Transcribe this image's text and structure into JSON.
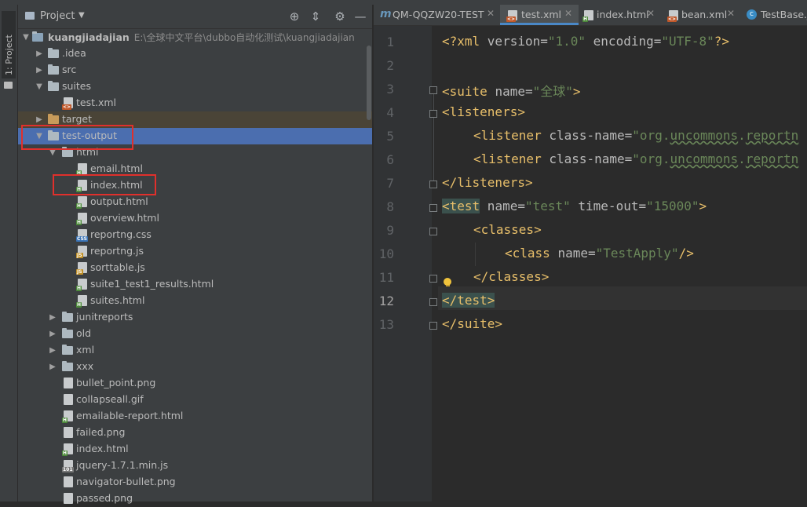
{
  "side_strip": {
    "tab_label": "1: Project"
  },
  "project_panel": {
    "title": "Project",
    "tree": [
      {
        "label": "kuangjiadajian",
        "path": "E:\\全球中文平台\\dubbo自动化测试\\kuangjiadajian",
        "icon": "module-folder-icon"
      },
      {
        "label": ".idea",
        "icon": "folder-icon"
      },
      {
        "label": "src",
        "icon": "folder-icon"
      },
      {
        "label": "suites",
        "icon": "folder-icon"
      },
      {
        "label": "test.xml",
        "icon": "xml-file-icon"
      },
      {
        "label": "target",
        "icon": "folder-icon"
      },
      {
        "label": "test-output",
        "icon": "folder-icon"
      },
      {
        "label": "html",
        "icon": "folder-icon"
      },
      {
        "label": "email.html",
        "icon": "html-file-icon"
      },
      {
        "label": "index.html",
        "icon": "html-file-icon"
      },
      {
        "label": "output.html",
        "icon": "html-file-icon"
      },
      {
        "label": "overview.html",
        "icon": "html-file-icon"
      },
      {
        "label": "reportng.css",
        "icon": "css-file-icon"
      },
      {
        "label": "reportng.js",
        "icon": "js-file-icon"
      },
      {
        "label": "sorttable.js",
        "icon": "js-file-icon"
      },
      {
        "label": "suite1_test1_results.html",
        "icon": "html-file-icon"
      },
      {
        "label": "suites.html",
        "icon": "html-file-icon"
      },
      {
        "label": "junitreports",
        "icon": "folder-icon"
      },
      {
        "label": "old",
        "icon": "folder-icon"
      },
      {
        "label": "xml",
        "icon": "folder-icon"
      },
      {
        "label": "xxx",
        "icon": "folder-icon"
      },
      {
        "label": "bullet_point.png",
        "icon": "image-file-icon"
      },
      {
        "label": "collapseall.gif",
        "icon": "image-file-icon"
      },
      {
        "label": "emailable-report.html",
        "icon": "html-file-icon"
      },
      {
        "label": "failed.png",
        "icon": "image-file-icon"
      },
      {
        "label": "index.html",
        "icon": "html-file-icon"
      },
      {
        "label": "jquery-1.7.1.min.js",
        "icon": "js-file-icon"
      },
      {
        "label": "navigator-bullet.png",
        "icon": "image-file-icon"
      },
      {
        "label": "passed.png",
        "icon": "image-file-icon"
      }
    ]
  },
  "editor": {
    "tabs": [
      {
        "label": "QM-QQZW20-TEST",
        "active": false
      },
      {
        "label": "test.xml",
        "active": true
      },
      {
        "label": "index.html",
        "active": false
      },
      {
        "label": "bean.xml",
        "active": false
      },
      {
        "label": "TestBase.j",
        "active": false
      }
    ],
    "line_numbers": [
      "1",
      "2",
      "3",
      "4",
      "5",
      "6",
      "7",
      "8",
      "9",
      "10",
      "11",
      "12",
      "13"
    ],
    "current_line": "12",
    "code": {
      "l1_open": "<?xml ",
      "l1_attr1": "version=",
      "l1_val1": "\"1.0\"",
      "l1_attr2": " encoding=",
      "l1_val2": "\"UTF-8\"",
      "l1_close": "?>",
      "l3_tag": "<suite ",
      "l3_attr": "name=",
      "l3_val": "\"全球\"",
      "l3_end": ">",
      "l4": "<listeners>",
      "l5_tag": "<listener ",
      "l5_attr": "class-name=",
      "l5_val_a": "\"org.",
      "l5_val_b": "uncommons",
      "l5_val_c": ".",
      "l5_val_d": "reportn",
      "l6_tag": "<listener ",
      "l6_attr": "class-name=",
      "l6_val_a": "\"org.",
      "l6_val_b": "uncommons",
      "l6_val_c": ".",
      "l6_val_d": "reportn",
      "l7": "</listeners>",
      "l8_tag": "<test",
      "l8_attr1": " name=",
      "l8_val1": "\"test\"",
      "l8_attr2": " time-out=",
      "l8_val2": "\"15000\"",
      "l8_end": ">",
      "l9": "<classes>",
      "l10_tag": "<class ",
      "l10_attr": "name=",
      "l10_val": "\"TestApply\"",
      "l10_end": "/>",
      "l11": "</classes>",
      "l12": "</test>",
      "l13": "</suite>"
    }
  }
}
